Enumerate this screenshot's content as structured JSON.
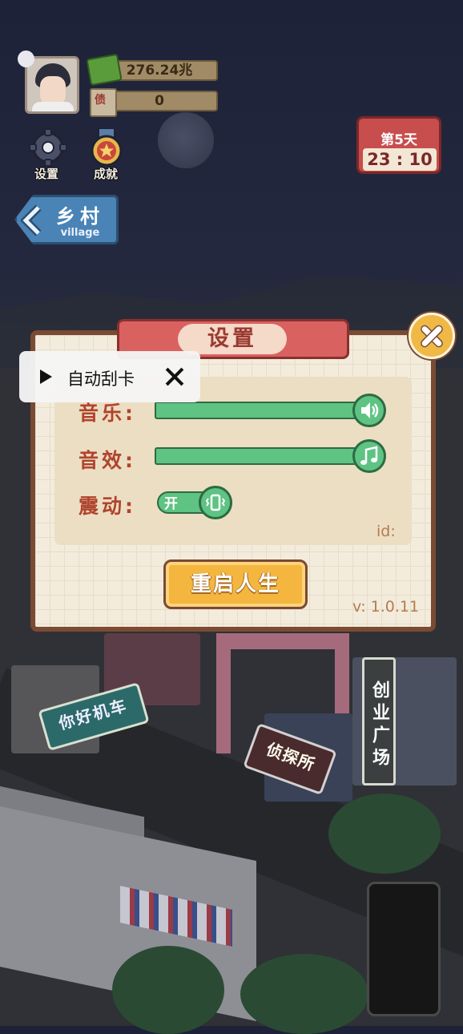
{
  "hud": {
    "money": "276.24兆",
    "tickets": "0",
    "ticket_icon_char": "债",
    "settings_label": "设置",
    "achievements_label": "成就"
  },
  "location": {
    "title": "乡村",
    "subtitle": "village"
  },
  "calendar": {
    "day": "第5天",
    "time": "23 : 10"
  },
  "scene_signs": {
    "car_shop": "你好机车",
    "detective": "侦探所",
    "plaza": "创业广场"
  },
  "settings": {
    "title": "设置",
    "music_label": "音乐:",
    "sfx_label": "音效:",
    "vibration_label": "震动:",
    "vibration_state": "开",
    "music_level": 1.0,
    "sfx_level": 1.0,
    "vibration_on": true,
    "id_label": "id:",
    "restart_label": "重启人生",
    "version": "v: 1.0.11"
  },
  "popup": {
    "label": "自动刮卡"
  },
  "colors": {
    "accent_green": "#5ec383",
    "ribbon_red": "#d9615f",
    "button_gold": "#f4b63f",
    "frame_brown": "#7a4a33"
  },
  "icons": [
    "gear-icon",
    "medal-icon",
    "chevron-left-icon",
    "money-icon",
    "ticket-icon",
    "speaker-icon",
    "music-note-icon",
    "vibrate-icon",
    "close-icon",
    "play-icon"
  ]
}
